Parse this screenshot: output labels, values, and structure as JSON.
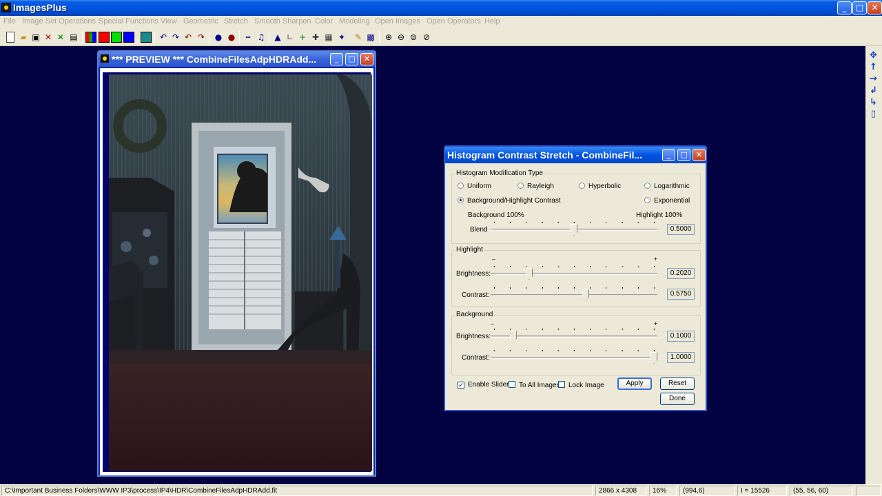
{
  "app": {
    "title": "ImagesPlus"
  },
  "menu": [
    "File",
    "Image Set Operations",
    "Special Functions",
    "View",
    "Geometric",
    "Stretch",
    "Smooth Sharpen",
    "Color",
    "Modeling",
    "Open Images",
    "Open Operators",
    "Help"
  ],
  "preview": {
    "title": "*** PREVIEW *** CombineFilesAdpHDRAdd..."
  },
  "dialog": {
    "title": "Histogram Contrast Stretch - CombineFil...",
    "modification": {
      "legend": "Histogram Modification Type",
      "options": [
        "Uniform",
        "Rayleigh",
        "Hyperbolic",
        "Logarithmic",
        "Background/Highlight Contrast",
        "Exponential"
      ],
      "selected": "Background/Highlight Contrast",
      "background_label": "Background 100%",
      "highlight_label": "Highlight 100%",
      "blend_label": "Blend",
      "blend_value": "0.5000",
      "blend_level": 0.5
    },
    "highlight": {
      "legend": "Highlight",
      "minus": "–",
      "plus": "+",
      "brightness_label": "Brightness:",
      "brightness_value": "0.2020",
      "brightness_level": 0.22,
      "contrast_label": "Contrast:",
      "contrast_value": "0.5750",
      "contrast_level": 0.575
    },
    "background": {
      "legend": "Background",
      "minus": "–",
      "plus": "+",
      "brightness_label": "Brightness:",
      "brightness_value": "0.1000",
      "brightness_level": 0.12,
      "contrast_label": "Contrast:",
      "contrast_value": "1.0000",
      "contrast_level": 1.0
    },
    "enable_slider": {
      "label": "Enable Slider",
      "checked": true
    },
    "to_all_images": {
      "label": "To All Images",
      "checked": false
    },
    "lock_image": {
      "label": "Lock Image",
      "checked": false
    },
    "apply": "Apply",
    "reset": "Reset",
    "done": "Done"
  },
  "statusbar": {
    "path": "C:\\Important Business Folders\\WWW IP3\\process\\IP4\\HDR\\CombineFilesAdpHDRAdd.fit",
    "dimensions": "2866 x 4308",
    "zoom": "16%",
    "coords": "(994,6)",
    "intensity": "I = 15526",
    "rgb": "(55, 56, 60)"
  },
  "colors": {
    "desktop": "#030240",
    "title_blue": "#0054e3",
    "close_red": "#c8401e"
  }
}
